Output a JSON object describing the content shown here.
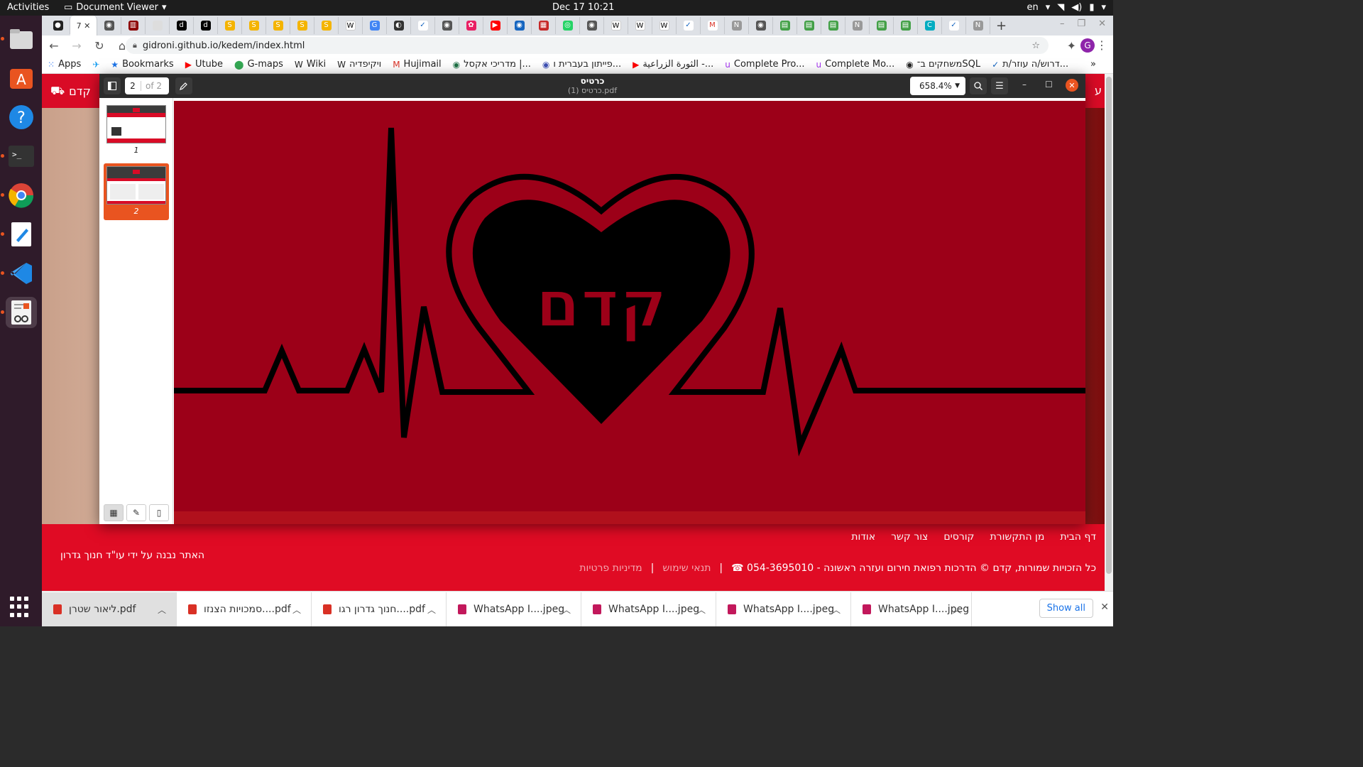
{
  "topbar": {
    "activities": "Activities",
    "app_name": "Document Viewer",
    "clock": "Dec 17  10:21",
    "lang": "en"
  },
  "dock": {
    "items": [
      "files-icon",
      "software-icon",
      "help-icon",
      "terminal-icon",
      "chrome-icon",
      "text-editor-icon",
      "vscode-icon",
      "document-viewer-icon"
    ]
  },
  "browser": {
    "url": "gidroni.github.io/kedem/index.html",
    "tab_active_label": "7",
    "bookmarks": [
      "Apps",
      "Bookmarks",
      "Utube",
      "G-maps",
      "Wiki",
      "ויקיפדיה",
      "Hujimail",
      "מדריכי אקסל |...",
      "פייתון בעברית ו...",
      "الثورة الزراعية -...",
      "Complete Pro...",
      "Complete Mo...",
      "משחקים ב־SQL",
      "דרוש/ה עוזר/ת..."
    ]
  },
  "site": {
    "brand": "קדם",
    "header_right": "ע",
    "footer_nav": [
      "דף הבית",
      "מן התקשורת",
      "קורסים",
      "צור קשר",
      "אודות"
    ],
    "footer_credit": "האתר נבנה על ידי עו\"ד חנוך גדרון",
    "footer_copyright": "כל הזכויות שמורות, קדם © הדרכות רפואת חירום ועזרה ראשונה - 054-3695010 ☎",
    "footer_terms": "תנאי שימוש",
    "footer_privacy": "מדיניות פרטיות",
    "separator": "|"
  },
  "downloads": {
    "items": [
      {
        "name": "ליאור שטרן.pdf",
        "color": "#d93025"
      },
      {
        "name": "סמכויות הצנזו....pdf",
        "color": "#d93025"
      },
      {
        "name": "חנוך גדרון רגו....pdf",
        "color": "#d93025"
      },
      {
        "name": "WhatsApp I....jpeg",
        "color": "#c2185b"
      },
      {
        "name": "WhatsApp I....jpeg",
        "color": "#c2185b"
      },
      {
        "name": "WhatsApp I....jpeg",
        "color": "#c2185b"
      },
      {
        "name": "WhatsApp I....jpeg",
        "color": "#c2185b"
      }
    ],
    "show_all": "Show all"
  },
  "viewer": {
    "title": "כרטיס",
    "subtitle": "כרטיס (1).pdf",
    "current_page": "2",
    "page_total": "of 2",
    "zoom": "658.4%",
    "thumbnails": [
      {
        "label": "1"
      },
      {
        "label": "2"
      }
    ],
    "page_logo_text": "קדם",
    "page_bg_color": "#9c0018"
  }
}
